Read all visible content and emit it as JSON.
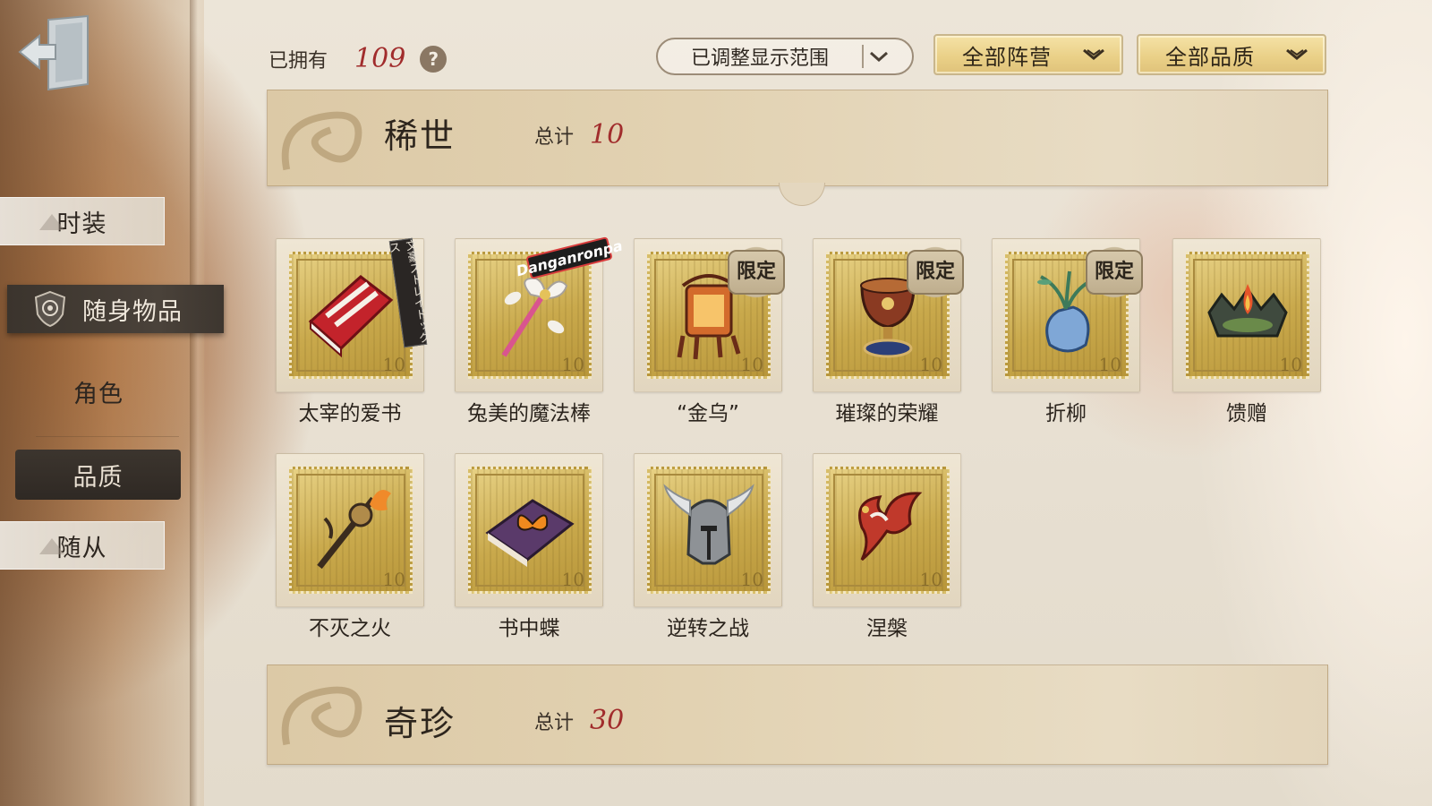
{
  "sidebar": {
    "exit_icon": "exit-door-icon",
    "items": [
      {
        "label": "时装",
        "style": "light"
      },
      {
        "label": "随身物品",
        "style": "active",
        "icon": "shield-emblem-icon"
      },
      {
        "label": "角色",
        "style": "plain"
      },
      {
        "label": "品质",
        "style": "dark"
      },
      {
        "label": "随从",
        "style": "light"
      }
    ]
  },
  "topbar": {
    "owned_label": "已拥有",
    "owned_count": "109",
    "help_icon": "question-icon",
    "help_glyph": "?",
    "range_filter": "已调整显示范围",
    "faction_filter": "全部阵营",
    "quality_filter": "全部品质"
  },
  "sections": [
    {
      "title": "稀世",
      "total_label": "总计",
      "total": "10",
      "items": [
        {
          "name": "太宰的爱书",
          "limited": false,
          "art": "red-book-icon",
          "side_tag": "文豪ストレイドッグス"
        },
        {
          "name": "兔美的魔法棒",
          "limited": false,
          "art": "magic-wand-icon",
          "collab_tag": "Danganronpa"
        },
        {
          "name": "“金乌”",
          "limited": true,
          "art": "golden-crow-lantern-icon"
        },
        {
          "name": "璀璨的荣耀",
          "limited": true,
          "art": "ornate-trophy-icon"
        },
        {
          "name": "折柳",
          "limited": true,
          "art": "willow-vase-icon"
        },
        {
          "name": "馈赠",
          "limited": false,
          "art": "flaming-crown-icon"
        },
        {
          "name": "不灭之火",
          "limited": false,
          "art": "flaming-scepter-icon"
        },
        {
          "name": "书中蝶",
          "limited": false,
          "art": "butterfly-book-icon"
        },
        {
          "name": "逆转之战",
          "limited": false,
          "art": "winged-helmet-icon"
        },
        {
          "name": "涅槃",
          "limited": false,
          "art": "phoenix-icon"
        }
      ],
      "limited_label": "限定",
      "stamp_value": "10"
    },
    {
      "title": "奇珍",
      "total_label": "总计",
      "total": "30"
    }
  ],
  "colors": {
    "accent_red": "#a12c2c",
    "gold": "#c9a94c",
    "sidebar_dark": "#3b342d"
  }
}
